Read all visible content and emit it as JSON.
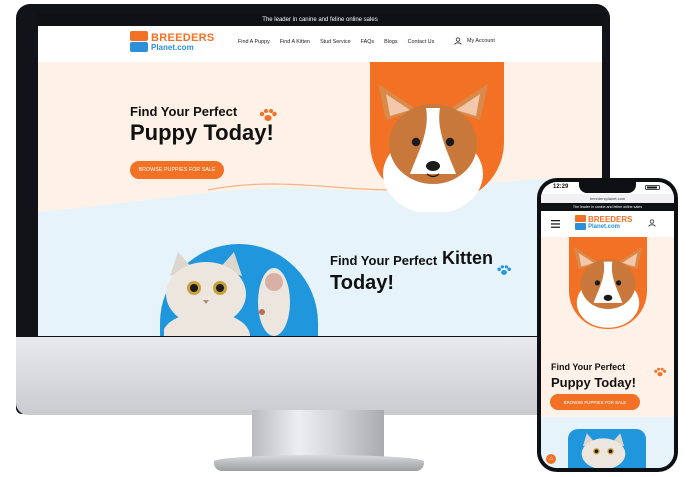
{
  "desktop": {
    "topbar_text": "The leader in canine and feline online sales",
    "logo": {
      "line1": "BREEDERS",
      "line2": "Planet.com"
    },
    "nav": {
      "items": [
        "Find A Puppy",
        "Find A Kitten",
        "Stud Service",
        "FAQs",
        "Blogs",
        "Contact Us"
      ],
      "account_label": "My Account"
    },
    "hero_puppy": {
      "heading_small": "Find Your Perfect",
      "heading_big": "Puppy Today!",
      "cta_label": "BROWSE PUPPIES FOR SALE"
    },
    "hero_kitten": {
      "heading_small": "Find Your Perfect",
      "heading_accent": "Kitten",
      "heading_big": "Today!"
    }
  },
  "mobile": {
    "time": "12:29",
    "url": "breedersplanet.com",
    "topbar_text": "The leader in canine and feline online sales",
    "logo": {
      "line1": "BREEDERS",
      "line2": "Planet.com"
    },
    "hero": {
      "heading_small": "Find Your Perfect",
      "heading_big": "Puppy Today!",
      "cta_label": "BROWSE PUPPIES FOR SALE"
    }
  },
  "colors": {
    "brand_orange": "#f27125",
    "brand_blue": "#2096dc",
    "hero_cream": "#fdf1e8",
    "hero_blue": "#e6f3fb"
  },
  "icons": [
    "account-icon",
    "hamburger-icon",
    "paw-icon",
    "home-icon"
  ]
}
